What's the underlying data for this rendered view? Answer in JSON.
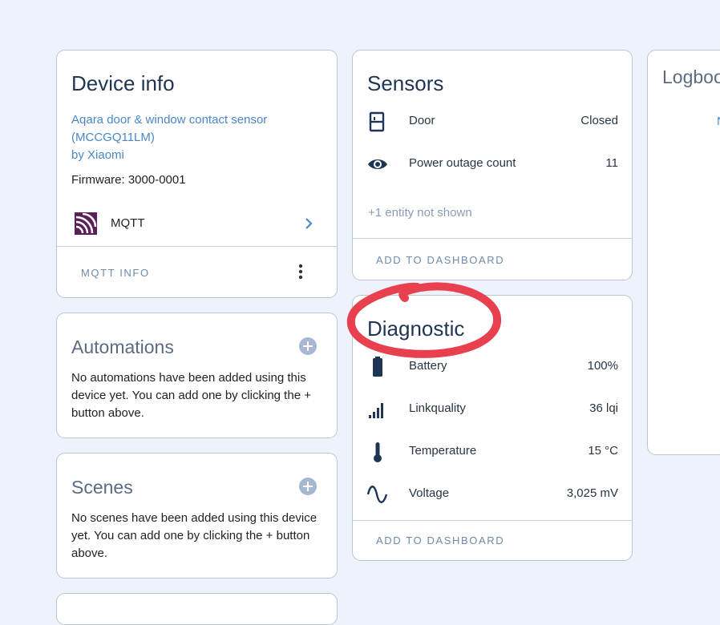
{
  "device_info": {
    "title": "Device info",
    "model_line1": "Aqara door & window contact sensor",
    "model_line2": "(MCCGQ11LM)",
    "manufacturer": "by Xiaomi",
    "firmware": "Firmware: 3000-0001",
    "integration": "MQTT",
    "action_label": "MQTT INFO"
  },
  "automations": {
    "title": "Automations",
    "text": "No automations have been added using this device yet. You can add one by clicking the + button above."
  },
  "scenes": {
    "title": "Scenes",
    "text": "No scenes have been added using this device yet. You can add one by clicking the + button above."
  },
  "sensors": {
    "title": "Sensors",
    "rows": [
      {
        "label": "Door",
        "value": "Closed",
        "icon": "door-icon"
      },
      {
        "label": "Power outage count",
        "value": "11",
        "icon": "eye-icon"
      }
    ],
    "hidden_note": "+1 entity not shown",
    "action_label": "ADD TO DASHBOARD"
  },
  "diagnostic": {
    "title": "Diagnostic",
    "rows": [
      {
        "label": "Battery",
        "value": "100%",
        "icon": "battery-icon"
      },
      {
        "label": "Linkquality",
        "value": "36 lqi",
        "icon": "signal-icon"
      },
      {
        "label": "Temperature",
        "value": "15 °C",
        "icon": "thermometer-icon"
      },
      {
        "label": "Voltage",
        "value": "3,025 mV",
        "icon": "sine-wave-icon"
      }
    ],
    "action_label": "ADD TO DASHBOARD",
    "annotation_color": "#e8404f"
  },
  "logbook": {
    "title": "Logboo",
    "partial_text": "N"
  }
}
